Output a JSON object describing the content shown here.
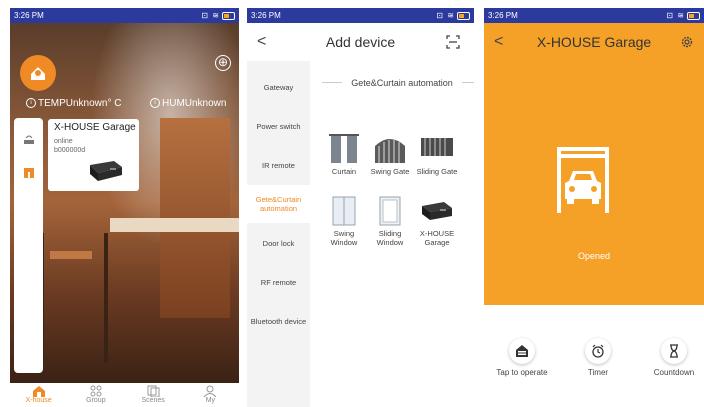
{
  "screens": [
    {
      "status_time": "3:26 PM",
      "plus": "⊕",
      "temp": "TEMPUnknown° C",
      "hum": "HUMUnknown",
      "device": {
        "name": "X-HOUSE Garage",
        "status": "online",
        "id": "b000000d"
      },
      "nav": [
        "X-house",
        "Group",
        "Scenes",
        "My"
      ]
    },
    {
      "status_time": "3:26 PM",
      "title": "Add device",
      "back": "<",
      "categories": [
        "Gateway",
        "Power switch",
        "IR remote",
        "Gete&Curtain automation",
        "Door lock",
        "RF remote",
        "Bluetooth device"
      ],
      "section_title": "Gete&Curtain automation",
      "devices": [
        "Curtain",
        "Swing Gate",
        "Sliding Gate",
        "Swing Window",
        "Sliding Window",
        "X-HOUSE Garage"
      ]
    },
    {
      "status_time": "3:26 PM",
      "title": "X-HOUSE Garage",
      "back": "<",
      "state": "Opened",
      "actions": [
        "Tap to operate",
        "Timer",
        "Countdown"
      ]
    }
  ],
  "colors": {
    "status_bar": "#2b3a9c",
    "accent": "#f08a24",
    "garage_bg": "#f5a128"
  }
}
